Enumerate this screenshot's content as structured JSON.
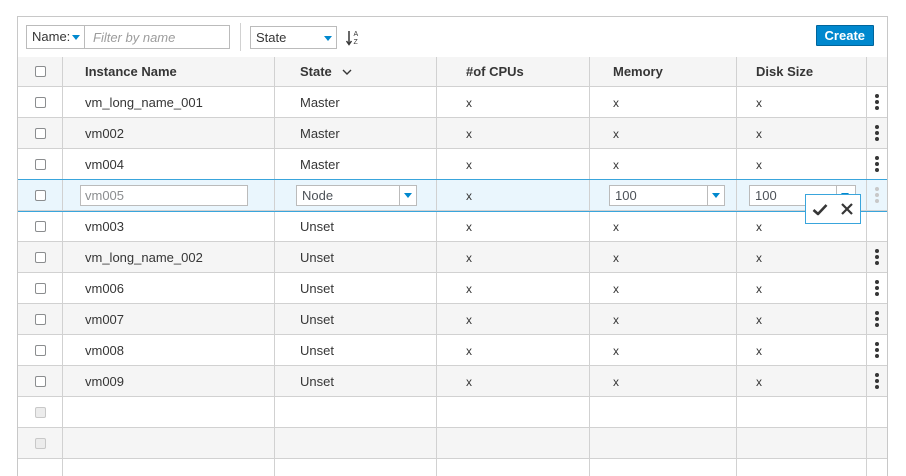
{
  "toolbar": {
    "filter_type_label": "Name:",
    "filter_placeholder": "Filter by name",
    "state_select_value": "State",
    "create_label": "Create"
  },
  "table": {
    "columns": [
      "Instance Name",
      "State",
      "#of CPUs",
      "Memory",
      "Disk Size"
    ],
    "rows": [
      {
        "name": "vm_long_name_001",
        "state": "Master",
        "cpus": "x",
        "memory": "x",
        "disk": "x"
      },
      {
        "name": "vm002",
        "state": "Master",
        "cpus": "x",
        "memory": "x",
        "disk": "x"
      },
      {
        "name": "vm004",
        "state": "Master",
        "cpus": "x",
        "memory": "x",
        "disk": "x"
      },
      {
        "name": "vm005",
        "state": "Node",
        "cpus": "x",
        "memory": "100",
        "disk": "100"
      },
      {
        "name": "vm003",
        "state": "Unset",
        "cpus": "x",
        "memory": "x",
        "disk": "x"
      },
      {
        "name": "vm_long_name_002",
        "state": "Unset",
        "cpus": "x",
        "memory": "x",
        "disk": "x"
      },
      {
        "name": "vm006",
        "state": "Unset",
        "cpus": "x",
        "memory": "x",
        "disk": "x"
      },
      {
        "name": "vm007",
        "state": "Unset",
        "cpus": "x",
        "memory": "x",
        "disk": "x"
      },
      {
        "name": "vm008",
        "state": "Unset",
        "cpus": "x",
        "memory": "x",
        "disk": "x"
      },
      {
        "name": "vm009",
        "state": "Unset",
        "cpus": "x",
        "memory": "x",
        "disk": "x"
      }
    ]
  },
  "icons": {
    "filter_caret": "chevron-down-icon",
    "sort": "sort-alpha-asc-icon",
    "state_sort": "chevron-down-icon",
    "row_actions": "kebab-icon",
    "confirm": "check-icon",
    "cancel": "close-icon"
  },
  "colors": {
    "accent": "#0088ce",
    "edit_row_bg": "#eaf6fd",
    "edit_row_border": "#39a5dc",
    "stripe": "#f5f5f5",
    "border": "#d1d1d1"
  }
}
